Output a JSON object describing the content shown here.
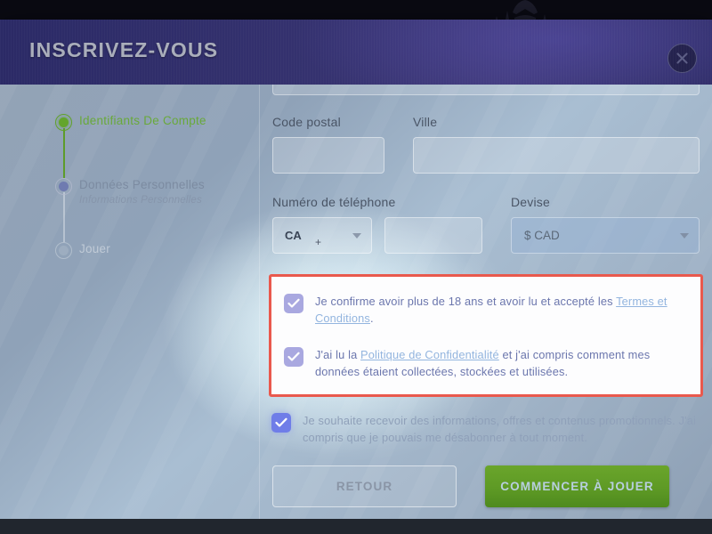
{
  "modal": {
    "title": "INSCRIVEZ-VOUS",
    "close_icon": "close-x-icon"
  },
  "sidebar": {
    "steps": [
      {
        "title": "Identifiants De Compte",
        "subtitle": "",
        "state": "completed"
      },
      {
        "title": "Données Personnelles",
        "subtitle": "Informations Personnelles",
        "state": "current"
      },
      {
        "title": "Jouer",
        "subtitle": "",
        "state": "pending"
      }
    ]
  },
  "form": {
    "fields": {
      "postal_code": {
        "label": "Code postal",
        "value": "",
        "placeholder": ""
      },
      "city": {
        "label": "Ville",
        "value": "",
        "placeholder": ""
      },
      "phone": {
        "label": "Numéro de téléphone",
        "value": "",
        "placeholder": ""
      },
      "currency": {
        "label": "Devise",
        "value": "$ CAD"
      }
    },
    "country": {
      "code": "CA",
      "prefix": "+",
      "caret_icon": "chevron-down-icon"
    }
  },
  "consent": {
    "highlight_color": "#e9594d",
    "terms": {
      "text_before": "Je confirme avoir plus de 18 ans et avoir lu et accepté les ",
      "link": "Termes et Conditions",
      "text_after": ".",
      "checked": true
    },
    "privacy": {
      "text_before": "J'ai lu la ",
      "link": "Politique de Confidentialité",
      "text_after": " et j'ai compris comment mes données étaient collectées, stockées et utilisées.",
      "checked": true
    },
    "promotions": {
      "text": "Je souhaite recevoir des informations, offres et contenus promotionnels. J'ai compris que je pouvais me désabonner à tout moment.",
      "checked": true
    },
    "check_icon": "checkmark-icon"
  },
  "footer": {
    "back_label": "RETOUR",
    "play_label": "COMMENCER À JOUER",
    "play_color": "#5e9a25"
  }
}
